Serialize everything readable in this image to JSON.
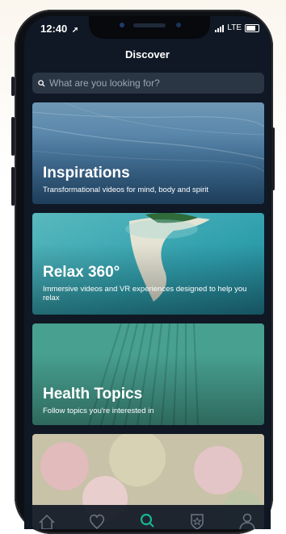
{
  "status_bar": {
    "time": "12:40",
    "network": "LTE"
  },
  "header": {
    "title": "Discover"
  },
  "search": {
    "placeholder": "What are you looking for?"
  },
  "cards": [
    {
      "title": "Inspirations",
      "subtitle": "Transformational videos for mind, body and spirit"
    },
    {
      "title": "Relax 360°",
      "subtitle": "Immersive videos and VR experiences designed to help you relax"
    },
    {
      "title": "Health Topics",
      "subtitle": "Follow topics you're interested in"
    },
    {
      "title": "",
      "subtitle": ""
    }
  ],
  "tab_bar": {
    "items": [
      {
        "icon": "home-icon",
        "active": false
      },
      {
        "icon": "heart-icon",
        "active": false
      },
      {
        "icon": "search-icon",
        "active": true
      },
      {
        "icon": "badge-icon",
        "active": false
      },
      {
        "icon": "profile-icon",
        "active": false
      }
    ]
  },
  "colors": {
    "accent": "#19b394",
    "screen_bg": "#0f1824",
    "search_bg": "#2a3644"
  }
}
